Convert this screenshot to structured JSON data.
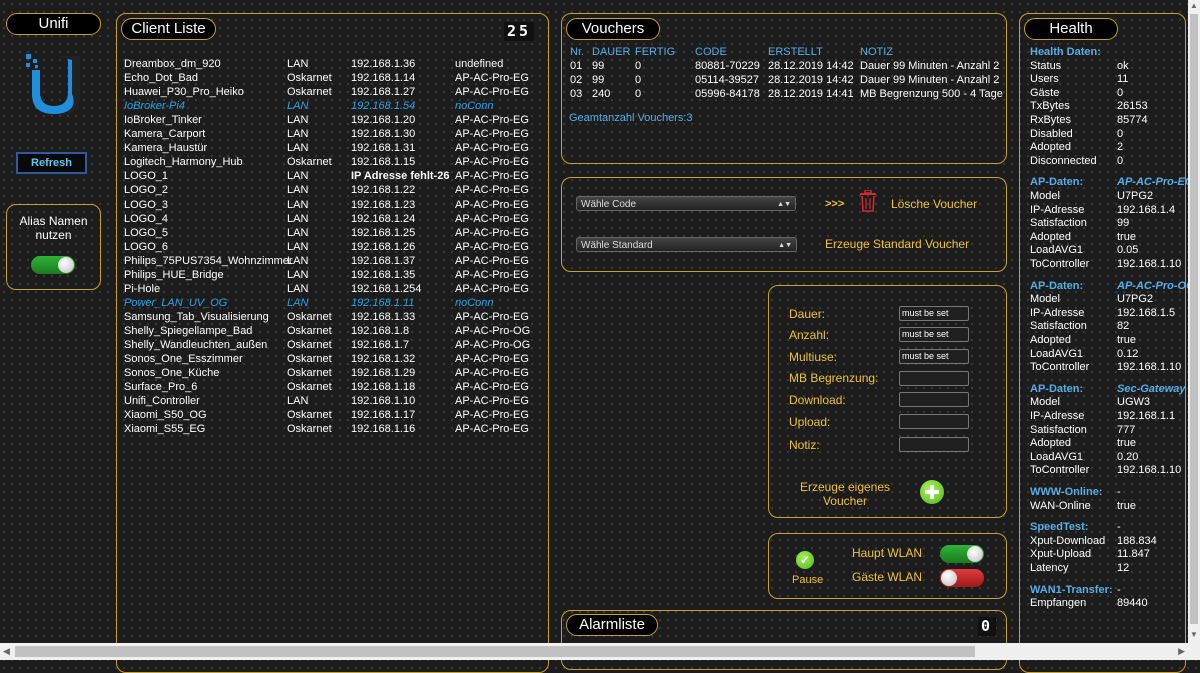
{
  "sidebar": {
    "title": "Unifi",
    "refresh_label": "Refresh",
    "alias_label_1": "Alias Namen",
    "alias_label_2": "nutzen",
    "alias_toggle": "on"
  },
  "clients": {
    "title": "Client Liste",
    "count": "25",
    "rows": [
      {
        "name": "Dreambox_dm_920",
        "net": "LAN",
        "ip": "192.168.1.36",
        "ap": "undefined",
        "state": "on"
      },
      {
        "name": "Echo_Dot_Bad",
        "net": "Oskarnet",
        "ip": "192.168.1.14",
        "ap": "AP-AC-Pro-EG",
        "state": "on"
      },
      {
        "name": "Huawei_P30_Pro_Heiko",
        "net": "Oskarnet",
        "ip": "192.168.1.27",
        "ap": "AP-AC-Pro-EG",
        "state": "on"
      },
      {
        "name": "IoBroker-Pi4",
        "net": "LAN",
        "ip": "192.168.1.54",
        "ap": "noConn",
        "state": "off"
      },
      {
        "name": "IoBroker_Tinker",
        "net": "LAN",
        "ip": "192.168.1.20",
        "ap": "AP-AC-Pro-EG",
        "state": "on"
      },
      {
        "name": "Kamera_Carport",
        "net": "LAN",
        "ip": "192.168.1.30",
        "ap": "AP-AC-Pro-EG",
        "state": "on"
      },
      {
        "name": "Kamera_Haustür",
        "net": "LAN",
        "ip": "192.168.1.31",
        "ap": "AP-AC-Pro-EG",
        "state": "on"
      },
      {
        "name": "Logitech_Harmony_Hub",
        "net": "Oskarnet",
        "ip": "192.168.1.15",
        "ap": "AP-AC-Pro-EG",
        "state": "on"
      },
      {
        "name": "LOGO_1",
        "net": "LAN",
        "ip": "IP Adresse fehlt-26",
        "ap": "AP-AC-Pro-EG",
        "state": "warn"
      },
      {
        "name": "LOGO_2",
        "net": "LAN",
        "ip": "192.168.1.22",
        "ap": "AP-AC-Pro-EG",
        "state": "on"
      },
      {
        "name": "LOGO_3",
        "net": "LAN",
        "ip": "192.168.1.23",
        "ap": "AP-AC-Pro-EG",
        "state": "on"
      },
      {
        "name": "LOGO_4",
        "net": "LAN",
        "ip": "192.168.1.24",
        "ap": "AP-AC-Pro-EG",
        "state": "on"
      },
      {
        "name": "LOGO_5",
        "net": "LAN",
        "ip": "192.168.1.25",
        "ap": "AP-AC-Pro-EG",
        "state": "on"
      },
      {
        "name": "LOGO_6",
        "net": "LAN",
        "ip": "192.168.1.26",
        "ap": "AP-AC-Pro-EG",
        "state": "on"
      },
      {
        "name": "Philips_75PUS7354_Wohnzimmer",
        "net": "LAN",
        "ip": "192.168.1.37",
        "ap": "AP-AC-Pro-EG",
        "state": "on"
      },
      {
        "name": "Philips_HUE_Bridge",
        "net": "LAN",
        "ip": "192.168.1.35",
        "ap": "AP-AC-Pro-EG",
        "state": "on"
      },
      {
        "name": "Pi-Hole",
        "net": "LAN",
        "ip": "192.168.1.254",
        "ap": "AP-AC-Pro-EG",
        "state": "on"
      },
      {
        "name": "Power_LAN_UV_OG",
        "net": "LAN",
        "ip": "192.168.1.11",
        "ap": "noConn",
        "state": "off"
      },
      {
        "name": "Samsung_Tab_Visualisierung",
        "net": "Oskarnet",
        "ip": "192.168.1.33",
        "ap": "AP-AC-Pro-EG",
        "state": "on"
      },
      {
        "name": "Shelly_Spiegellampe_Bad",
        "net": "Oskarnet",
        "ip": "192.168.1.8",
        "ap": "AP-AC-Pro-OG",
        "state": "on"
      },
      {
        "name": "Shelly_Wandleuchten_außen",
        "net": "Oskarnet",
        "ip": "192.168.1.7",
        "ap": "AP-AC-Pro-OG",
        "state": "on"
      },
      {
        "name": "Sonos_One_Esszimmer",
        "net": "Oskarnet",
        "ip": "192.168.1.32",
        "ap": "AP-AC-Pro-EG",
        "state": "on"
      },
      {
        "name": "Sonos_One_Küche",
        "net": "Oskarnet",
        "ip": "192.168.1.29",
        "ap": "AP-AC-Pro-EG",
        "state": "on"
      },
      {
        "name": "Surface_Pro_6",
        "net": "Oskarnet",
        "ip": "192.168.1.18",
        "ap": "AP-AC-Pro-EG",
        "state": "on"
      },
      {
        "name": "Unifi_Controller",
        "net": "LAN",
        "ip": "192.168.1.10",
        "ap": "AP-AC-Pro-EG",
        "state": "on"
      },
      {
        "name": "Xiaomi_S50_OG",
        "net": "Oskarnet",
        "ip": "192.168.1.17",
        "ap": "AP-AC-Pro-EG",
        "state": "on"
      },
      {
        "name": "Xiaomi_S55_EG",
        "net": "Oskarnet",
        "ip": "192.168.1.16",
        "ap": "AP-AC-Pro-EG",
        "state": "on"
      }
    ]
  },
  "vouchers": {
    "title": "Vouchers",
    "headers": {
      "nr": "Nr.",
      "dauer": "DAUER",
      "fertig": "FERTIG",
      "code": "CODE",
      "erstellt": "ERSTELLT",
      "notiz": "NOTIZ"
    },
    "rows": [
      {
        "nr": "01",
        "dauer": "99",
        "fertig": "0",
        "code": "80881-70229",
        "erstellt": "28.12.2019 14:42",
        "notiz": "Dauer 99 Minuten - Anzahl 2"
      },
      {
        "nr": "02",
        "dauer": "99",
        "fertig": "0",
        "code": "05114-39527",
        "erstellt": "28.12.2019 14:42",
        "notiz": "Dauer 99 Minuten - Anzahl 2"
      },
      {
        "nr": "03",
        "dauer": "240",
        "fertig": "0",
        "code": "05996-84178",
        "erstellt": "28.12.2019 14:41",
        "notiz": "MB Begrenzung 500 - 4 Tage"
      }
    ],
    "total": "Geamtanzahl Vouchers:3"
  },
  "voucher_actions": {
    "select_code": "Wähle Code",
    "arrows": ">>>",
    "delete_label": "Lösche Voucher",
    "select_standard": "Wähle Standard",
    "create_standard": "Erzeuge Standard Voucher"
  },
  "voucher_form": {
    "dauer_label": "Dauer:",
    "anzahl_label": "Anzahl:",
    "multiuse_label": "Multiuse:",
    "mb_label": "MB Begrenzung:",
    "download_label": "Download:",
    "upload_label": "Upload:",
    "notiz_label": "Notiz:",
    "dauer_value": "must be set",
    "anzahl_value": "must be set",
    "multiuse_value": "must be set",
    "create_line1": "Erzeuge eigenes",
    "create_line2": "Voucher"
  },
  "wlan": {
    "pause_label": "Pause",
    "haupt_label": "Haupt WLAN",
    "gaeste_label": "Gäste WLAN",
    "haupt_state": "on",
    "gaeste_state": "off"
  },
  "alarm": {
    "title": "Alarmliste",
    "count": "0"
  },
  "health": {
    "title": "Health",
    "lines": [
      {
        "k": "Health Daten:",
        "v": "",
        "type": "head"
      },
      {
        "k": "Status",
        "v": "ok"
      },
      {
        "k": "Users",
        "v": "11"
      },
      {
        "k": "Gäste",
        "v": "0"
      },
      {
        "k": "TxBytes",
        "v": "26153"
      },
      {
        "k": "RxBytes",
        "v": "85774"
      },
      {
        "k": "Disabled",
        "v": "0"
      },
      {
        "k": "Adopted",
        "v": "2"
      },
      {
        "k": "Disconnected",
        "v": "0"
      },
      {
        "k": "",
        "v": "",
        "type": "gap"
      },
      {
        "k": "AP-Daten:",
        "v": "AP-AC-Pro-EG",
        "type": "head"
      },
      {
        "k": "Model",
        "v": "U7PG2"
      },
      {
        "k": "IP-Adresse",
        "v": "192.168.1.4"
      },
      {
        "k": "Satisfaction",
        "v": "99"
      },
      {
        "k": "Adopted",
        "v": "true"
      },
      {
        "k": "LoadAVG1",
        "v": "0.05"
      },
      {
        "k": "ToController",
        "v": "192.168.1.10"
      },
      {
        "k": "",
        "v": "",
        "type": "gap"
      },
      {
        "k": "AP-Daten:",
        "v": "AP-AC-Pro-OG",
        "type": "head"
      },
      {
        "k": "Model",
        "v": "U7PG2"
      },
      {
        "k": "IP-Adresse",
        "v": "192.168.1.5"
      },
      {
        "k": "Satisfaction",
        "v": "82"
      },
      {
        "k": "Adopted",
        "v": "true"
      },
      {
        "k": "LoadAVG1",
        "v": "0.12"
      },
      {
        "k": "ToController",
        "v": "192.168.1.10"
      },
      {
        "k": "",
        "v": "",
        "type": "gap"
      },
      {
        "k": "AP-Daten:",
        "v": "Sec-Gateway",
        "type": "head"
      },
      {
        "k": "Model",
        "v": "UGW3"
      },
      {
        "k": "IP-Adresse",
        "v": "192.168.1.1"
      },
      {
        "k": "Satisfaction",
        "v": "777"
      },
      {
        "k": "Adopted",
        "v": "true"
      },
      {
        "k": "LoadAVG1",
        "v": "0.20"
      },
      {
        "k": "ToController",
        "v": "192.168.1.10"
      },
      {
        "k": "",
        "v": "",
        "type": "gap"
      },
      {
        "k": "WWW-Online:",
        "v": "-",
        "type": "head2"
      },
      {
        "k": "WAN-Online",
        "v": "true"
      },
      {
        "k": "",
        "v": "",
        "type": "gap"
      },
      {
        "k": "SpeedTest:",
        "v": "-",
        "type": "head2"
      },
      {
        "k": "Xput-Download",
        "v": "188.834"
      },
      {
        "k": "Xput-Upload",
        "v": "11.847"
      },
      {
        "k": "Latency",
        "v": "12"
      },
      {
        "k": "",
        "v": "",
        "type": "gap"
      },
      {
        "k": "WAN1-Transfer:",
        "v": "-",
        "type": "head2"
      },
      {
        "k": "Empfangen",
        "v": "89440"
      }
    ]
  }
}
